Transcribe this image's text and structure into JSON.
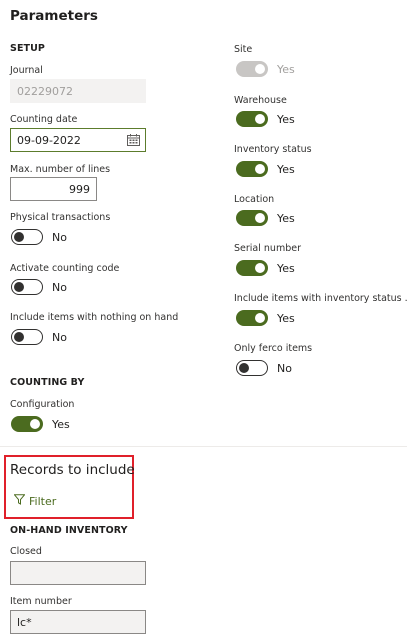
{
  "header": {
    "title": "Parameters"
  },
  "setup": {
    "title": "SETUP",
    "journal": {
      "label": "Journal",
      "value": "02229072"
    },
    "counting_date": {
      "label": "Counting date",
      "value": "09-09-2022"
    },
    "max_lines": {
      "label": "Max. number of lines",
      "value": "999"
    },
    "physical_transactions": {
      "label": "Physical transactions",
      "state": "No"
    },
    "activate_counting_code": {
      "label": "Activate counting code",
      "state": "No"
    },
    "include_nothing_on_hand": {
      "label": "Include items with nothing on hand",
      "state": "No"
    }
  },
  "right_column": {
    "site": {
      "label": "Site",
      "state": "Yes"
    },
    "warehouse": {
      "label": "Warehouse",
      "state": "Yes"
    },
    "inventory_status": {
      "label": "Inventory status",
      "state": "Yes"
    },
    "location": {
      "label": "Location",
      "state": "Yes"
    },
    "serial_number": {
      "label": "Serial number",
      "state": "Yes"
    },
    "include_inventory_status": {
      "label": "Include items with inventory status ...",
      "state": "Yes"
    },
    "only_ferco": {
      "label": "Only ferco items",
      "state": "No"
    }
  },
  "counting_by": {
    "title": "COUNTING BY",
    "configuration": {
      "label": "Configuration",
      "state": "Yes"
    }
  },
  "records": {
    "title": "Records to include",
    "filter_label": "Filter"
  },
  "on_hand": {
    "title": "ON-HAND INVENTORY",
    "closed": {
      "label": "Closed",
      "value": ""
    },
    "item_number": {
      "label": "Item number",
      "value": "lc*"
    }
  },
  "colors": {
    "accent": "#4b6b1f",
    "highlight": "#e0202a"
  }
}
